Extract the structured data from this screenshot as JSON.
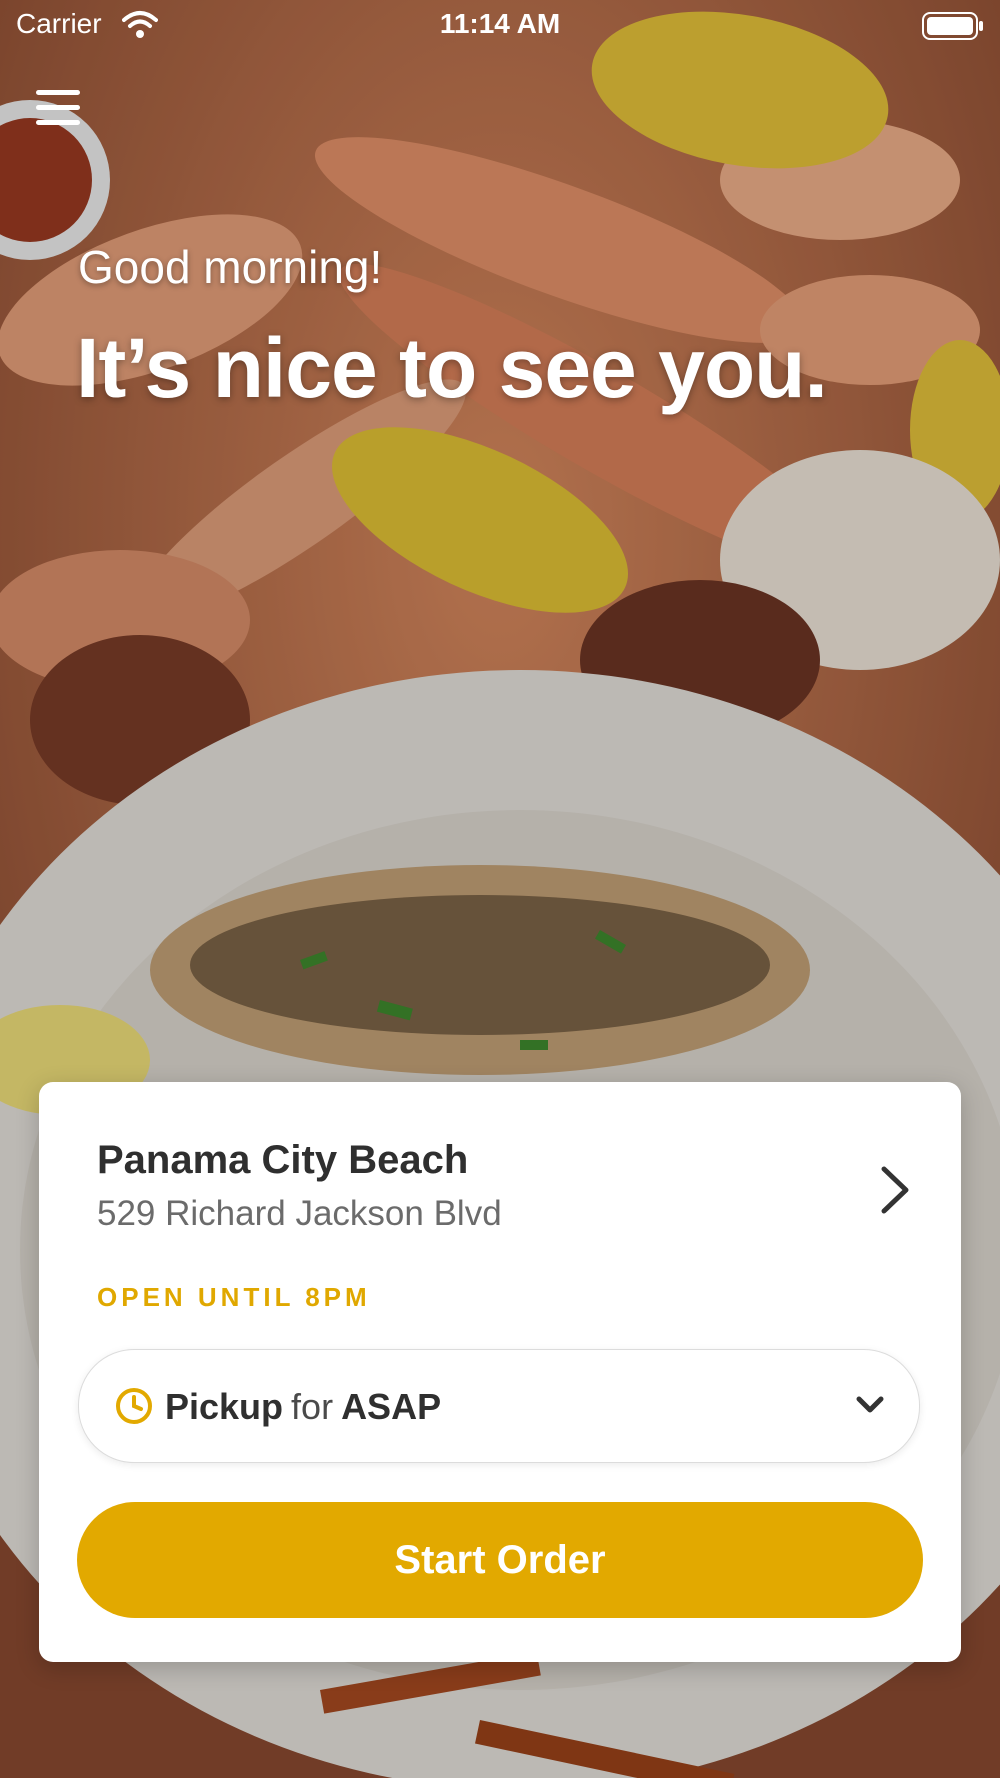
{
  "status_bar": {
    "carrier": "Carrier",
    "time": "11:14 AM"
  },
  "header": {
    "greeting": "Good morning!",
    "headline": "It’s nice to see you."
  },
  "location": {
    "name": "Panama City Beach",
    "address": "529 Richard Jackson Blvd",
    "hours": "OPEN UNTIL 8PM"
  },
  "order_type": {
    "mode": "Pickup",
    "connector": "for",
    "time": "ASAP"
  },
  "actions": {
    "start_order": "Start Order"
  },
  "colors": {
    "accent": "#e2a900",
    "hours_text": "#e0a800",
    "card_background": "#ffffff",
    "title_text": "#2f2f2f"
  },
  "icons": {
    "menu": "hamburger-menu-icon",
    "wifi": "wifi-icon",
    "battery": "battery-icon",
    "location_chevron": "chevron-right-icon",
    "clock": "clock-icon",
    "dropdown": "chevron-down-icon"
  }
}
